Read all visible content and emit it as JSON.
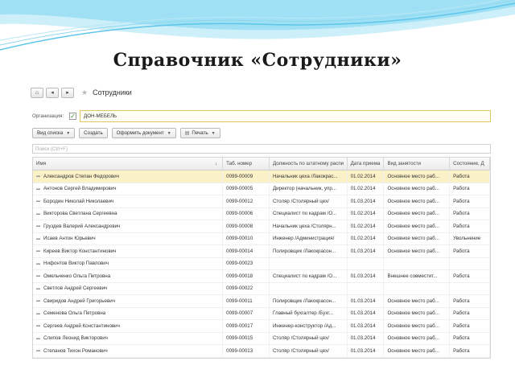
{
  "slide_title": "Справочник «Сотрудники»",
  "app": {
    "nav": {
      "home_icon": "home-icon",
      "back_icon": "back-arrow-icon",
      "forward_icon": "forward-arrow-icon"
    },
    "title": "Сотрудники",
    "org_label": "Организация:",
    "org_value": "ДОН-МЕБЕЛЬ",
    "commands": {
      "list_view": "Вид списка",
      "create": "Создать",
      "make_document": "Оформить документ",
      "print": "Печать"
    },
    "search_placeholder": "Поиск (Ctrl+F)",
    "columns": [
      "Имя",
      "Таб. номер",
      "Должность по штатному распи",
      "Дата приема",
      "Вид занятости",
      "Состояние, Д"
    ],
    "rows": [
      [
        "Александров Степан Федорович",
        "0099-00009",
        "Начальник цеха /Лакокрас...",
        "01.02.2014",
        "Основное место раб...",
        "Работа"
      ],
      [
        "Антонов Сергей Владимирович",
        "0099-00005",
        "Директор (начальник, упр...",
        "01.02.2014",
        "Основное место раб...",
        "Работа"
      ],
      [
        "Бородин Николай Николаевич",
        "0099-00012",
        "Столяр /Столярный цех/",
        "01.03.2014",
        "Основное место раб...",
        "Работа"
      ],
      [
        "Викторова Светлана Сергеевна",
        "0099-00006",
        "Специалист по кадрам /О...",
        "01.02.2014",
        "Основное место раб...",
        "Работа"
      ],
      [
        "Груздев Валерий Александрович",
        "0099-00008",
        "Начальник цеха /Столярн...",
        "01.02.2014",
        "Основное место раб...",
        "Работа"
      ],
      [
        "Исаев Антон Юрьевич",
        "0099-00010",
        "Инженер /Администрация/",
        "01.02.2014",
        "Основное место раб...",
        "Увольнение"
      ],
      [
        "Киреев Виктор Константинович",
        "0099-00014",
        "Полировщик /Лакокрасон...",
        "01.03.2014",
        "Основное место раб...",
        "Работа"
      ],
      [
        "Нифонтов Виктор Павлович",
        "0099-00023",
        "",
        "",
        "",
        ""
      ],
      [
        "Омельченко Ольга Петровна",
        "0099-00018",
        "Специалист по кадрам /О...",
        "01.03.2014",
        "Внешнее совместит...",
        "Работа"
      ],
      [
        "Светлов Андрей Сергеевич",
        "0099-00022",
        "",
        "",
        "",
        ""
      ],
      [
        "Свиридов Андрей Григорьевич",
        "0099-00011",
        "Полировщик /Лакокрасон...",
        "01.03.2014",
        "Основное место раб...",
        "Работа"
      ],
      [
        "Семенова Ольга Петровна",
        "0099-00007",
        "Главный бухгалтер /Бухг...",
        "01.03.2014",
        "Основное место раб...",
        "Работа"
      ],
      [
        "Сергеев Андрей Константинович",
        "0099-00017",
        "Инженер-конструктор /Ад...",
        "01.03.2014",
        "Основное место раб...",
        "Работа"
      ],
      [
        "Слипов Леонид Викторович",
        "0099-00015",
        "Столяр /Столярный цех/",
        "01.03.2014",
        "Основное место раб...",
        "Работа"
      ],
      [
        "Степанов Тихон Романович",
        "0099-00013",
        "Столяр /Столярный цех/",
        "01.03.2014",
        "Основное место раб...",
        "Работа"
      ]
    ],
    "selected_row": 0,
    "colors": {
      "selected_row": "#fbf1c7",
      "org_field_border": "#e3c567",
      "wave": "#7fd3ee"
    }
  }
}
